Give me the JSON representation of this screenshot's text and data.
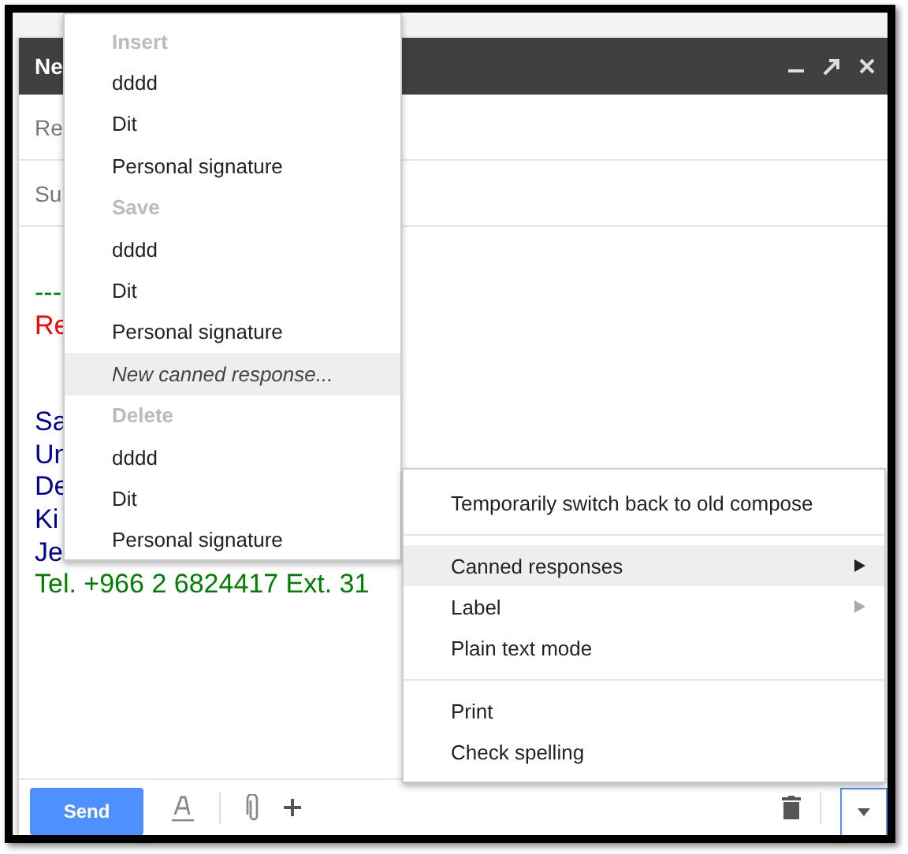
{
  "compose": {
    "title": "Ne",
    "recipients_placeholder": "Re",
    "subject_placeholder": "Su",
    "body_blocks": [
      [
        {
          "text": "---",
          "color": "#008000"
        },
        {
          "text": "Re",
          "color": "#ff0000"
        }
      ],
      [
        {
          "text": "Sa",
          "color": "#000099"
        },
        {
          "text": "Un",
          "color": "#000099"
        },
        {
          "text": "De",
          "color": "#000099"
        },
        {
          "text": "Ki",
          "color": "#000099"
        },
        {
          "text": "Je",
          "color": "#000099"
        },
        {
          "text": "Tel. +966 2 6824417 Ext. 31",
          "color": "#008000"
        }
      ]
    ],
    "send_label": "Send"
  },
  "canned_menu": [
    {
      "kind": "header",
      "label": "Insert"
    },
    {
      "kind": "item",
      "label": "dddd",
      "selected": false
    },
    {
      "kind": "item",
      "label": "Dit",
      "selected": false
    },
    {
      "kind": "item",
      "label": "Personal signature",
      "selected": false
    },
    {
      "kind": "header",
      "label": "Save"
    },
    {
      "kind": "item",
      "label": "dddd",
      "selected": false
    },
    {
      "kind": "item",
      "label": "Dit",
      "selected": false
    },
    {
      "kind": "item",
      "label": "Personal signature",
      "selected": false
    },
    {
      "kind": "action",
      "label": "New canned response...",
      "selected": true
    },
    {
      "kind": "header",
      "label": "Delete"
    },
    {
      "kind": "item",
      "label": "dddd",
      "selected": false
    },
    {
      "kind": "item",
      "label": "Dit",
      "selected": false
    },
    {
      "kind": "item",
      "label": "Personal signature",
      "selected": false
    }
  ],
  "more_menu": [
    {
      "kind": "item",
      "label": "Temporarily switch back to old compose",
      "selected": false,
      "submenu": false
    },
    {
      "kind": "separator"
    },
    {
      "kind": "item",
      "label": "Canned responses",
      "selected": true,
      "submenu": true
    },
    {
      "kind": "item",
      "label": "Label",
      "selected": false,
      "submenu": true
    },
    {
      "kind": "item",
      "label": "Plain text mode",
      "selected": false,
      "submenu": false
    },
    {
      "kind": "separator"
    },
    {
      "kind": "item",
      "label": "Print",
      "selected": false,
      "submenu": false
    },
    {
      "kind": "item",
      "label": "Check spelling",
      "selected": false,
      "submenu": false
    }
  ]
}
